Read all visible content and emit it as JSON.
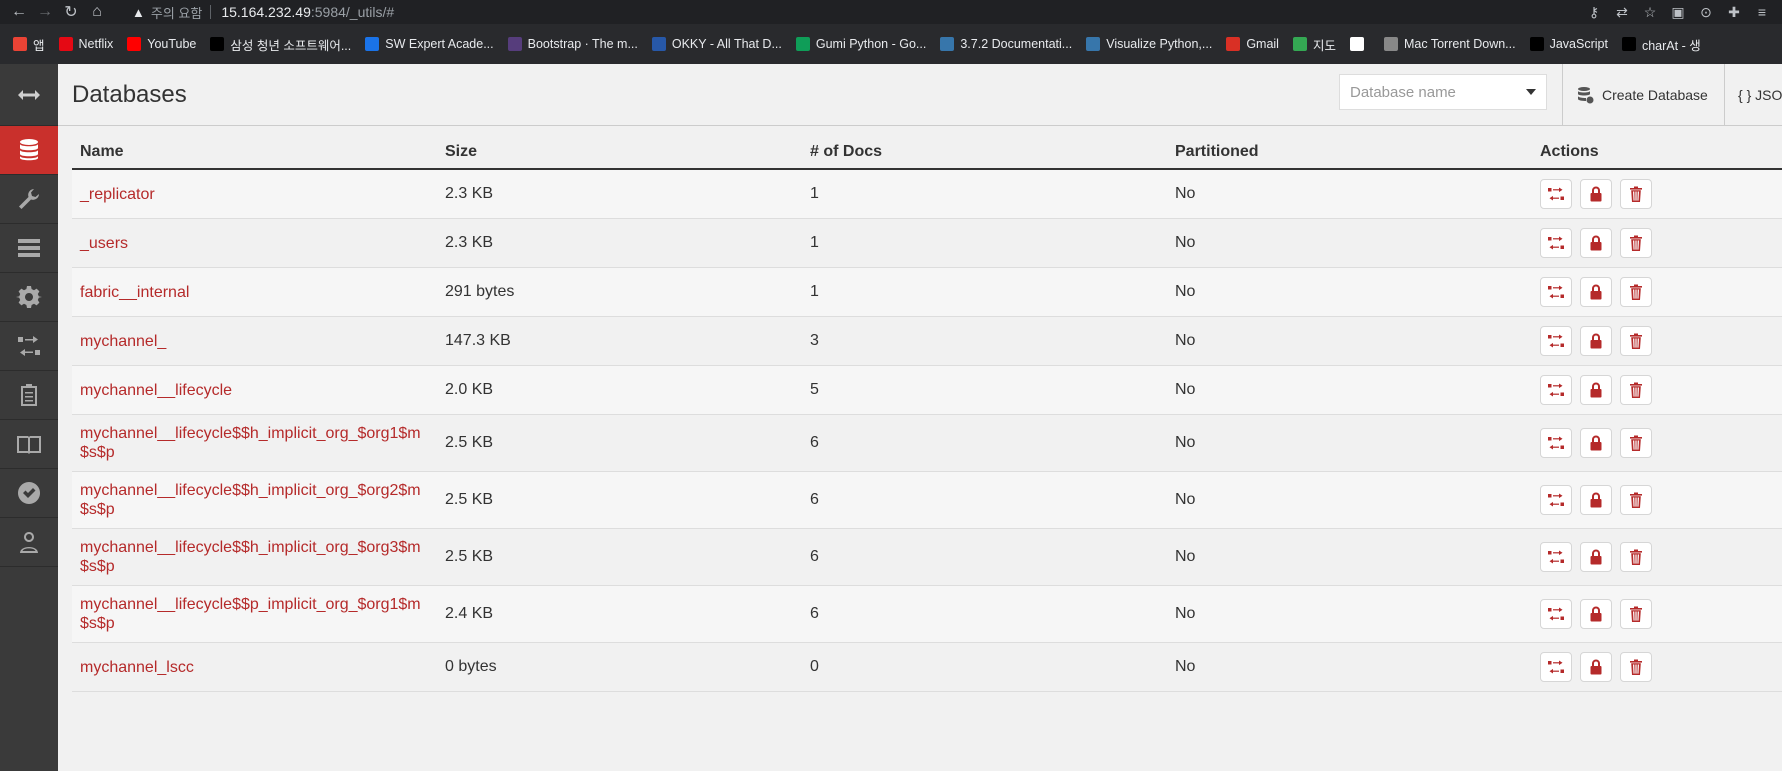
{
  "browser": {
    "security_label": "주의 요함",
    "url_host": "15.164.232.49",
    "url_rest": ":5984/_utils/#",
    "bookmarks": [
      {
        "label": "앱",
        "icon": "apps-icon",
        "color": "#ea4335"
      },
      {
        "label": "Netflix",
        "icon": "netflix-icon",
        "color": "#e50914"
      },
      {
        "label": "YouTube",
        "icon": "youtube-icon",
        "color": "#ff0000"
      },
      {
        "label": "삼성 청년 소프트웨어...",
        "icon": "samsung-icon",
        "color": "#000000"
      },
      {
        "label": "SW Expert Acade...",
        "icon": "swexpert-icon",
        "color": "#1a73e8"
      },
      {
        "label": "Bootstrap · The m...",
        "icon": "bootstrap-icon",
        "color": "#563d7c"
      },
      {
        "label": "OKKY - All That D...",
        "icon": "okky-icon",
        "color": "#2758a8"
      },
      {
        "label": "Gumi Python - Go...",
        "icon": "sheets-icon",
        "color": "#0f9d58"
      },
      {
        "label": "3.7.2 Documentati...",
        "icon": "python-icon",
        "color": "#3776ab"
      },
      {
        "label": "Visualize Python,...",
        "icon": "python-icon",
        "color": "#3776ab"
      },
      {
        "label": "Gmail",
        "icon": "gmail-icon",
        "color": "#d93025"
      },
      {
        "label": "지도",
        "icon": "maps-icon",
        "color": "#34a853"
      },
      {
        "label": "",
        "icon": "google-icon",
        "color": "#ffffff"
      },
      {
        "label": "Mac Torrent Down...",
        "icon": "torrent-icon",
        "color": "#888888"
      },
      {
        "label": "JavaScript",
        "icon": "javascript-icon",
        "color": "#000000"
      },
      {
        "label": "charAt - 생",
        "icon": "charat-icon",
        "color": "#000000"
      }
    ]
  },
  "header": {
    "title": "Databases",
    "db_placeholder": "Database name",
    "create_label": "Create Database",
    "json_label": "{ } JSON"
  },
  "table": {
    "columns": [
      "Name",
      "Size",
      "# of Docs",
      "Partitioned",
      "Actions"
    ],
    "rows": [
      {
        "name": "_replicator",
        "size": "2.3 KB",
        "docs": "1",
        "partitioned": "No"
      },
      {
        "name": "_users",
        "size": "2.3 KB",
        "docs": "1",
        "partitioned": "No"
      },
      {
        "name": "fabric__internal",
        "size": "291 bytes",
        "docs": "1",
        "partitioned": "No"
      },
      {
        "name": "mychannel_",
        "size": "147.3 KB",
        "docs": "3",
        "partitioned": "No"
      },
      {
        "name": "mychannel__lifecycle",
        "size": "2.0 KB",
        "docs": "5",
        "partitioned": "No"
      },
      {
        "name": "mychannel__lifecycle$$h_implicit_org_$org1$m$s$p",
        "size": "2.5 KB",
        "docs": "6",
        "partitioned": "No"
      },
      {
        "name": "mychannel__lifecycle$$h_implicit_org_$org2$m$s$p",
        "size": "2.5 KB",
        "docs": "6",
        "partitioned": "No"
      },
      {
        "name": "mychannel__lifecycle$$h_implicit_org_$org3$m$s$p",
        "size": "2.5 KB",
        "docs": "6",
        "partitioned": "No"
      },
      {
        "name": "mychannel__lifecycle$$p_implicit_org_$org1$m$s$p",
        "size": "2.4 KB",
        "docs": "6",
        "partitioned": "No"
      },
      {
        "name": "mychannel_lscc",
        "size": "0 bytes",
        "docs": "0",
        "partitioned": "No"
      }
    ]
  },
  "sidebar": {
    "items": [
      "toggle-arrows-icon",
      "database-icon",
      "wrench-icon",
      "list-icon",
      "gear-icon",
      "replication-icon",
      "clipboard-icon",
      "book-icon",
      "check-icon",
      "user-icon"
    ]
  }
}
